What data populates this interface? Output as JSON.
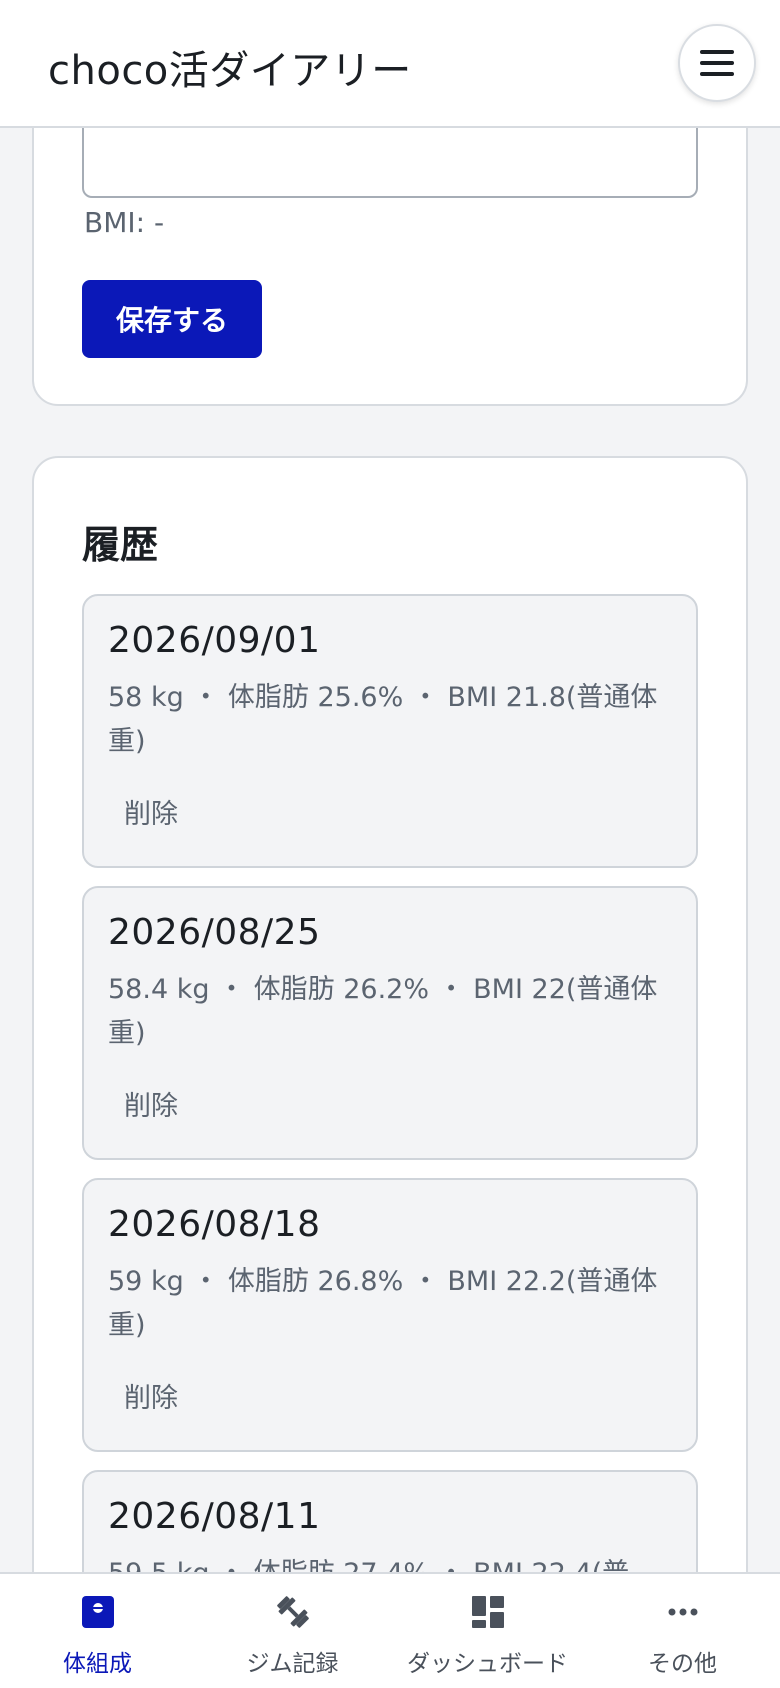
{
  "header": {
    "title": "choco活ダイアリー",
    "menu_icon": "hamburger-menu-icon"
  },
  "form": {
    "bmi_text": "BMI: -",
    "save_label": "保存する"
  },
  "history": {
    "title": "履歴",
    "delete_label": "削除",
    "entries": [
      {
        "date": "2026/09/01",
        "stats": "58 kg ・ 体脂肪 25.6% ・ BMI 21.8(普通体重)"
      },
      {
        "date": "2026/08/25",
        "stats": "58.4 kg ・ 体脂肪 26.2% ・ BMI 22(普通体重)"
      },
      {
        "date": "2026/08/18",
        "stats": "59 kg ・ 体脂肪 26.8% ・ BMI 22.2(普通体重)"
      },
      {
        "date": "2026/08/11",
        "stats": "59.5 kg ・ 体脂肪 27.4% ・ BMI 22.4(普"
      }
    ]
  },
  "bottom_nav": {
    "items": [
      {
        "label": "体組成",
        "icon": "body-composition-icon",
        "active": true
      },
      {
        "label": "ジム記録",
        "icon": "dumbbell-icon",
        "active": false
      },
      {
        "label": "ダッシュボード",
        "icon": "dashboard-icon",
        "active": false
      },
      {
        "label": "その他",
        "icon": "more-icon",
        "active": false
      }
    ]
  },
  "colors": {
    "primary": "#0b18b8",
    "background": "#f3f4f6",
    "card": "#ffffff",
    "muted_text": "#5b6470",
    "border": "#d7dbe0"
  }
}
